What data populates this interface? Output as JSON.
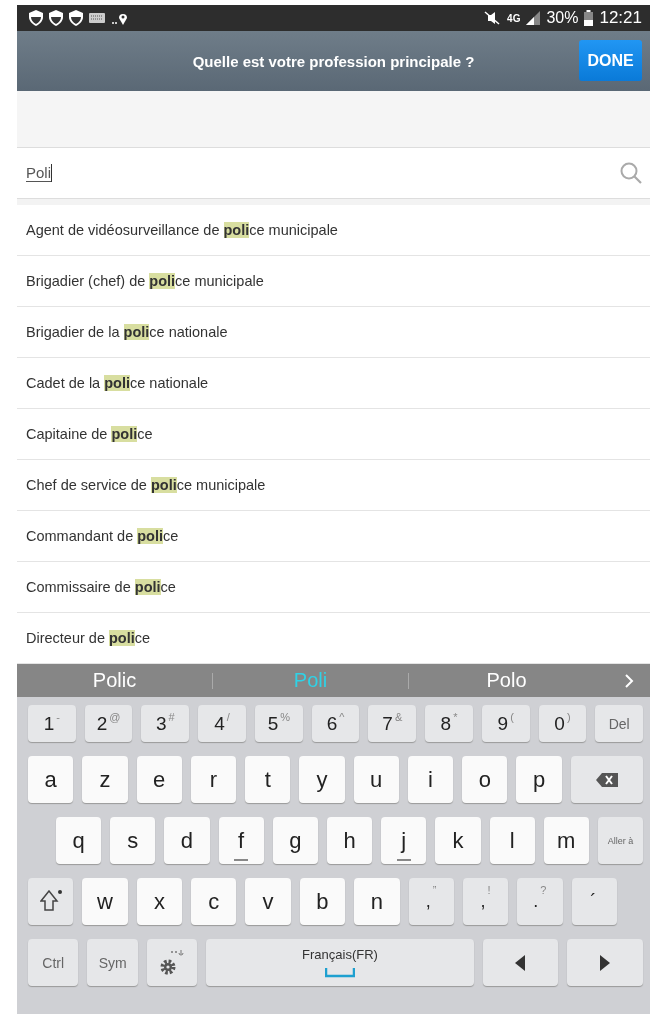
{
  "status_bar": {
    "network": "4G",
    "battery": "30%",
    "time": "12:21"
  },
  "header": {
    "title": "Quelle est votre profession principale ?",
    "done": "DONE"
  },
  "search": {
    "value": "Poli"
  },
  "results": [
    {
      "text": "Agent de vidéosurveillance de **poli**ce municipale"
    },
    {
      "text": "Brigadier (chef) de **poli**ce municipale"
    },
    {
      "text": "Brigadier de la **poli**ce nationale"
    },
    {
      "text": "Cadet de la **poli**ce nationale"
    },
    {
      "text": "Capitaine de **poli**ce"
    },
    {
      "text": "Chef de service de **poli**ce municipale"
    },
    {
      "text": "Commandant de **poli**ce"
    },
    {
      "text": "Commissaire de **poli**ce"
    },
    {
      "text": "Directeur de **poli**ce"
    }
  ],
  "suggestions": [
    {
      "text": "Polic",
      "selected": false
    },
    {
      "text": "Poli",
      "selected": true
    },
    {
      "text": "Polo",
      "selected": false
    }
  ],
  "keyboard": {
    "rows": [
      {
        "keys": [
          {
            "kind": "digit",
            "label": "1",
            "sub": "-"
          },
          {
            "kind": "digit",
            "label": "2",
            "sub": "@"
          },
          {
            "kind": "digit",
            "label": "3",
            "sub": "#"
          },
          {
            "kind": "digit",
            "label": "4",
            "sub": "/"
          },
          {
            "kind": "digit",
            "label": "5",
            "sub": "%"
          },
          {
            "kind": "digit",
            "label": "6",
            "sub": "^"
          },
          {
            "kind": "digit",
            "label": "7",
            "sub": "&"
          },
          {
            "kind": "digit",
            "label": "8",
            "sub": "*"
          },
          {
            "kind": "digit",
            "label": "9",
            "sub": "("
          },
          {
            "kind": "digit",
            "label": "0",
            "sub": ")"
          },
          {
            "kind": "func",
            "label": "Del"
          }
        ]
      },
      {
        "keys": [
          {
            "kind": "letter",
            "label": "a"
          },
          {
            "kind": "letter",
            "label": "z"
          },
          {
            "kind": "letter",
            "label": "e"
          },
          {
            "kind": "letter",
            "label": "r"
          },
          {
            "kind": "letter",
            "label": "t"
          },
          {
            "kind": "letter",
            "label": "y"
          },
          {
            "kind": "letter",
            "label": "u"
          },
          {
            "kind": "letter",
            "label": "i"
          },
          {
            "kind": "letter",
            "label": "o"
          },
          {
            "kind": "letter",
            "label": "p"
          },
          {
            "kind": "backspace"
          }
        ]
      },
      {
        "keys": [
          {
            "kind": "letter",
            "label": "q"
          },
          {
            "kind": "letter",
            "label": "s"
          },
          {
            "kind": "letter",
            "label": "d"
          },
          {
            "kind": "homing",
            "label": "f"
          },
          {
            "kind": "letter",
            "label": "g"
          },
          {
            "kind": "letter",
            "label": "h"
          },
          {
            "kind": "homing",
            "label": "j"
          },
          {
            "kind": "letter",
            "label": "k"
          },
          {
            "kind": "letter",
            "label": "l"
          },
          {
            "kind": "letter",
            "label": "m"
          },
          {
            "kind": "small",
            "label": "Aller à"
          }
        ]
      },
      {
        "keys": [
          {
            "kind": "shift"
          },
          {
            "kind": "letter",
            "label": "w"
          },
          {
            "kind": "letter",
            "label": "x"
          },
          {
            "kind": "letter",
            "label": "c"
          },
          {
            "kind": "letter",
            "label": "v"
          },
          {
            "kind": "letter",
            "label": "b"
          },
          {
            "kind": "letter",
            "label": "n"
          },
          {
            "kind": "punct",
            "label": ",",
            "sub": "”"
          },
          {
            "kind": "punct",
            "label": ",",
            "sub": "!"
          },
          {
            "kind": "punct",
            "label": ".",
            "sub": "?"
          },
          {
            "kind": "punct",
            "label": "´"
          }
        ]
      },
      {
        "keys": [
          {
            "kind": "func",
            "label": "Ctrl"
          },
          {
            "kind": "func",
            "label": "Sym"
          },
          {
            "kind": "settings"
          },
          {
            "kind": "space",
            "label": "Français(FR)"
          },
          {
            "kind": "left"
          },
          {
            "kind": "right"
          }
        ]
      }
    ]
  }
}
